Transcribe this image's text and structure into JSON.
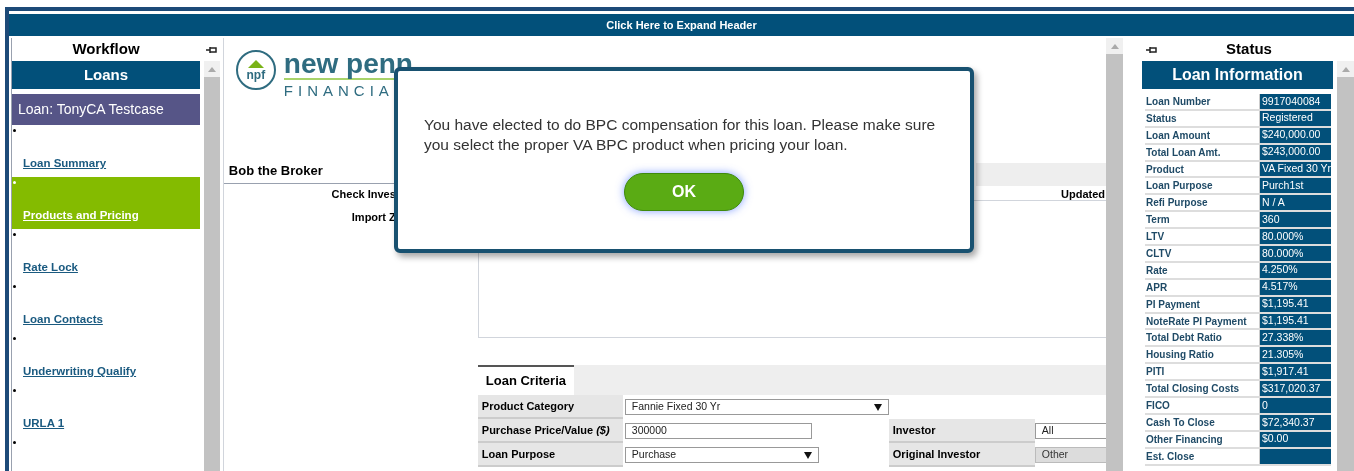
{
  "header_bar": {
    "label": "Click Here to Expand Header"
  },
  "workflow": {
    "title": "Workflow",
    "section": "Loans",
    "loan": "Loan: TonyCA Testcase",
    "items": [
      {
        "label": "Loan Summary",
        "selected": false
      },
      {
        "label": "Products and Pricing",
        "selected": true
      },
      {
        "label": "Rate Lock",
        "selected": false
      },
      {
        "label": "Loan Contacts",
        "selected": false
      },
      {
        "label": "Underwriting Qualify",
        "selected": false
      },
      {
        "label": "URLA 1",
        "selected": false
      }
    ]
  },
  "main": {
    "logo": {
      "name": "new penn",
      "sub": "FINANCIA",
      "badge": "npf"
    },
    "broker": "Bob the Broker",
    "labels": [
      "Check Inves",
      "Import Z"
    ],
    "updated": "Updated",
    "tab": "Loan Criteria",
    "form_rows": [
      {
        "label": "Product Category",
        "field": {
          "kind": "select",
          "value": "Fannie Fixed 30 Yr"
        }
      },
      {
        "label": "Purchase Price/Value *($)*",
        "field": {
          "kind": "input",
          "value": "300000"
        },
        "right_label": "Investor",
        "right_field": {
          "value": "All",
          "disabled": false
        }
      },
      {
        "label": "Loan Purpose",
        "field": {
          "kind": "select",
          "value": "Purchase"
        },
        "right_label": "Original Investor",
        "right_field": {
          "value": "Other",
          "disabled": true
        }
      }
    ]
  },
  "status": {
    "title": "Status",
    "section": "Loan Information",
    "rows": [
      {
        "label": "Loan Number",
        "value": "9917040084"
      },
      {
        "label": "Status",
        "value": "Registered"
      },
      {
        "label": "Loan Amount",
        "value": "$240,000.00"
      },
      {
        "label": "Total Loan Amt.",
        "value": "$243,000.00"
      },
      {
        "label": "Product",
        "value": "VA Fixed 30 Yr"
      },
      {
        "label": "Loan Purpose",
        "value": "Purch1st"
      },
      {
        "label": "Refi Purpose",
        "value": "N / A"
      },
      {
        "label": "Term",
        "value": "360"
      },
      {
        "label": "LTV",
        "value": "80.000%"
      },
      {
        "label": "CLTV",
        "value": "80.000%"
      },
      {
        "label": "Rate",
        "value": "4.250%"
      },
      {
        "label": "APR",
        "value": "4.517%"
      },
      {
        "label": "PI Payment",
        "value": "$1,195.41"
      },
      {
        "label": "NoteRate PI Payment",
        "value": "$1,195.41"
      },
      {
        "label": "Total Debt Ratio",
        "value": "27.338%"
      },
      {
        "label": "Housing Ratio",
        "value": "21.305%"
      },
      {
        "label": "PITI",
        "value": "$1,917.41"
      },
      {
        "label": "Total Closing Costs",
        "value": "$317,020.37"
      },
      {
        "label": "FICO",
        "value": "0"
      },
      {
        "label": "Cash To Close",
        "value": "$72,340.37"
      },
      {
        "label": "Other Financing",
        "value": "$0.00"
      },
      {
        "label": "Est. Close"
      }
    ]
  },
  "dialog": {
    "message": "You have elected to do BPC compensation for this loan. Please make sure you select the proper VA BPC product when pricing your loan.",
    "button": "OK"
  }
}
